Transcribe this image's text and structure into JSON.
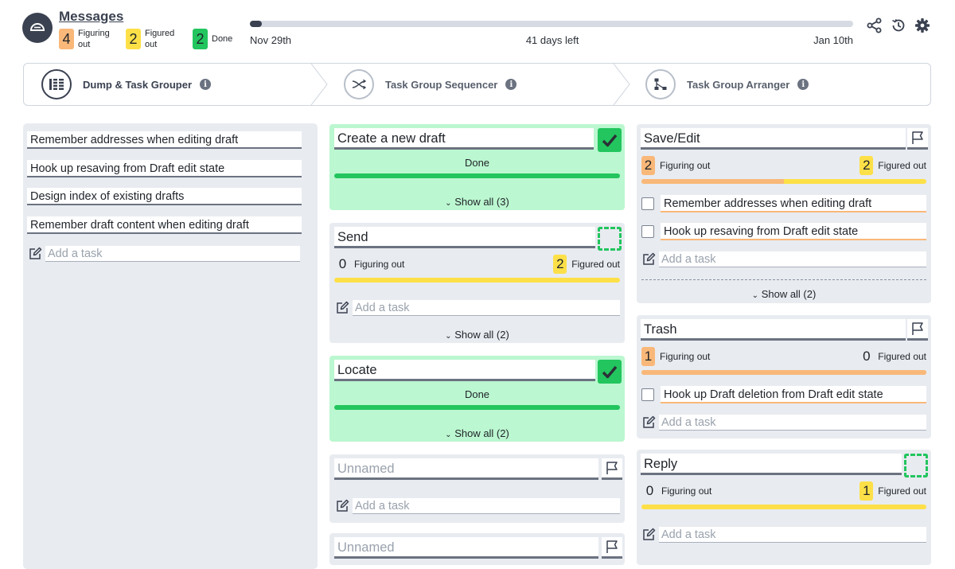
{
  "header": {
    "title": "Messages",
    "summary": [
      {
        "count": "4",
        "label": "Figuring out",
        "color": "#f9b879"
      },
      {
        "count": "2",
        "label": "Figured out",
        "color": "#fde047"
      },
      {
        "count": "2",
        "label": "Done",
        "color": "#22c55e"
      }
    ],
    "timeline": {
      "start": "Nov 29th",
      "remaining": "41 days left",
      "end": "Jan 10th",
      "progress_percent": 2
    },
    "tools": [
      "share-icon",
      "history-icon",
      "gear-icon"
    ]
  },
  "stepper": {
    "steps": [
      {
        "label": "Dump & Task Grouper",
        "icon": "grouper-icon",
        "active": true
      },
      {
        "label": "Task Group Sequencer",
        "icon": "sequencer-icon",
        "active": false
      },
      {
        "label": "Task Group Arranger",
        "icon": "arranger-icon",
        "active": false
      }
    ]
  },
  "dump": {
    "tasks": [
      "Remember addresses when editing draft",
      "Hook up resaving from Draft edit state",
      "Design index of existing drafts",
      "Remember draft content when editing draft"
    ],
    "add_placeholder": "Add a task"
  },
  "groups_mid": [
    {
      "title": "Create a new draft",
      "status": "Done",
      "show_all": "Show all (3)"
    },
    {
      "title": "Send",
      "figuring_count": "0",
      "figuring_label": "Figuring out",
      "figured_count": "2",
      "figured_label": "Figured out",
      "add_placeholder": "Add a task",
      "show_all": "Show all (2)"
    },
    {
      "title": "Locate",
      "status": "Done",
      "show_all": "Show all (2)"
    },
    {
      "title": "Unnamed",
      "add_placeholder": "Add a task"
    },
    {
      "title": "Unnamed"
    }
  ],
  "groups_right": [
    {
      "title": "Save/Edit",
      "figuring_count": "2",
      "figuring_label": "Figuring out",
      "figured_count": "2",
      "figured_label": "Figured out",
      "subtasks": [
        "Remember addresses when editing draft",
        "Hook up resaving from Draft edit state"
      ],
      "add_placeholder": "Add a task",
      "show_all": "Show all (2)",
      "progress_figuring_percent": 50
    },
    {
      "title": "Trash",
      "figuring_count": "1",
      "figuring_label": "Figuring out",
      "figured_count": "0",
      "figured_label": "Figured out",
      "subtasks": [
        "Hook up Draft deletion from Draft edit state"
      ],
      "add_placeholder": "Add a task",
      "progress_figuring_percent": 100
    },
    {
      "title": "Reply",
      "figuring_count": "0",
      "figuring_label": "Figuring out",
      "figured_count": "1",
      "figured_label": "Figured out",
      "add_placeholder": "Add a task",
      "progress_figuring_percent": 0
    }
  ],
  "colors": {
    "figuring": "#f9b879",
    "figured": "#fde047",
    "done": "#22c55e",
    "done_bg": "#bbf7d0",
    "panel": "#e8ebf0",
    "dark": "#3a4150"
  }
}
